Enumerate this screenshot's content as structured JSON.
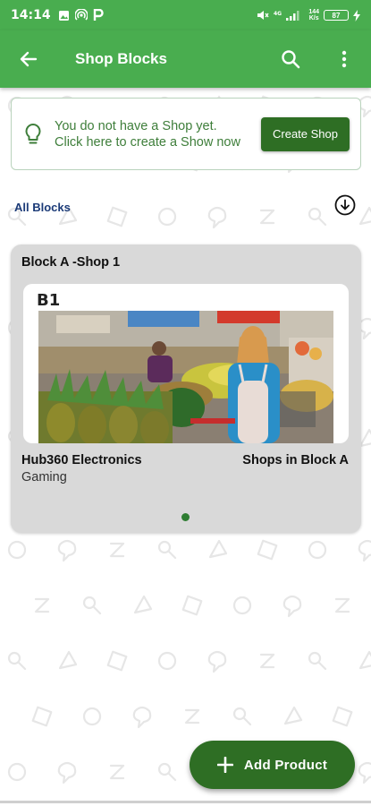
{
  "status_bar": {
    "time": "14:14",
    "network_speed": "144\nK/s",
    "battery": "87"
  },
  "app_bar": {
    "title": "Shop Blocks",
    "back_icon": "arrow-back-icon",
    "search_icon": "search-icon",
    "menu_icon": "more-vert-icon"
  },
  "banner": {
    "message": "You do not have a Shop yet. Click here to create a Show now",
    "button_label": "Create Shop"
  },
  "blocks": {
    "label": "All Blocks",
    "download_icon": "download-circle-icon"
  },
  "block_card": {
    "title": "Block A -Shop 1",
    "image_label": "B1",
    "shop_name": "Hub360 Electronics",
    "shop_category": "Gaming",
    "shops_in_block": "Shops in Block A"
  },
  "fab": {
    "label": "Add Product"
  },
  "colors": {
    "primary": "#49ad4f",
    "dark_green": "#2e6e24",
    "card_bg": "#d9d9d9",
    "link_blue": "#1c3b78"
  }
}
